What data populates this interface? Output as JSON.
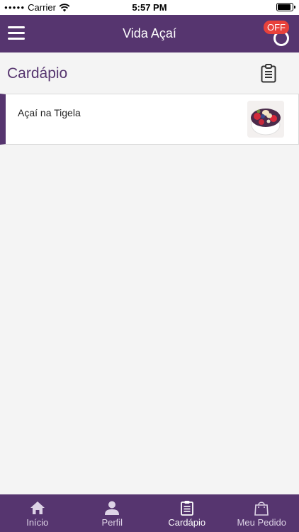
{
  "status_bar": {
    "carrier": "Carrier",
    "time": "5:57 PM"
  },
  "app_bar": {
    "title": "Vida Açaí",
    "store_status_badge": "OFF"
  },
  "section": {
    "title": "Cardápio"
  },
  "menu_items": [
    {
      "name": "Açaí na Tigela"
    }
  ],
  "tabs": [
    {
      "label": "Início",
      "icon": "home-icon",
      "active": false
    },
    {
      "label": "Perfil",
      "icon": "person-icon",
      "active": false
    },
    {
      "label": "Cardápio",
      "icon": "clipboard-icon",
      "active": true
    },
    {
      "label": "Meu Pedido",
      "icon": "shopping-bag-icon",
      "active": false
    }
  ],
  "colors": {
    "brand": "#56356f",
    "badge": "#e8413b",
    "background": "#f4f4f4"
  }
}
